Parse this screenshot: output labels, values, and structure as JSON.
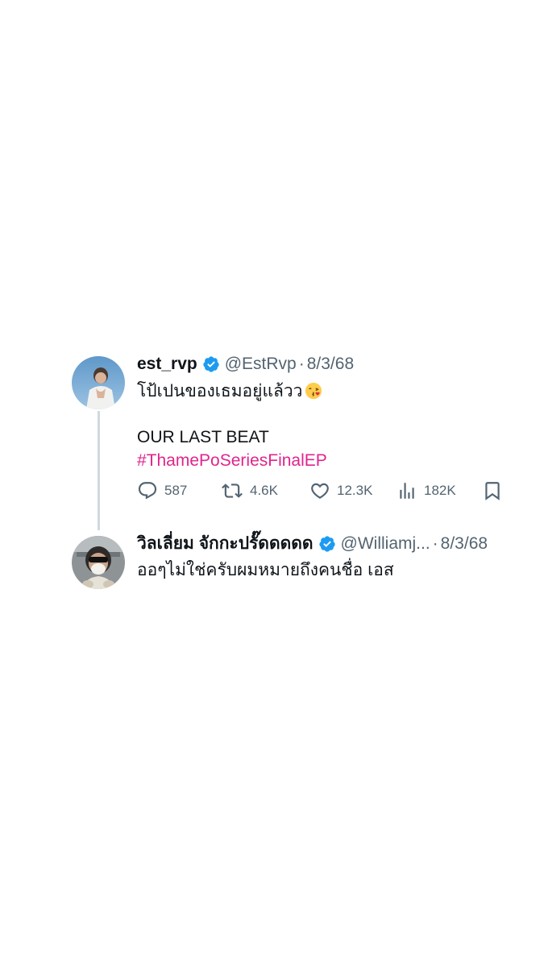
{
  "tweet": {
    "display_name": "est_rvp",
    "handle": "@EstRvp",
    "separator": "·",
    "date": "8/3/68",
    "text_line1": "โป้เปนของเธมอยู่แล้วว",
    "emoji": "kiss-face-emoji",
    "text_line2": "OUR LAST BEAT",
    "hashtag": "#ThamePoSeriesFinalEP",
    "replies": "587",
    "retweets": "4.6K",
    "likes": "12.3K",
    "views": "182K"
  },
  "reply": {
    "display_name": "วิลเลี่ยม จักกะปรั๊ดดดดด",
    "handle": "@Williamj...",
    "separator": "·",
    "date": "8/3/68",
    "text": "ออๆไม่ใช่ครับผมหมายถึงคนชื่อ เอส"
  },
  "colors": {
    "verified": "#1d9bf0",
    "hashtag": "#e0248d",
    "secondary_text": "#536471",
    "thread_line": "#cfd9de"
  },
  "icons": [
    "verified-badge-icon",
    "reply-icon",
    "retweet-icon",
    "like-icon",
    "views-icon",
    "bookmark-icon"
  ]
}
